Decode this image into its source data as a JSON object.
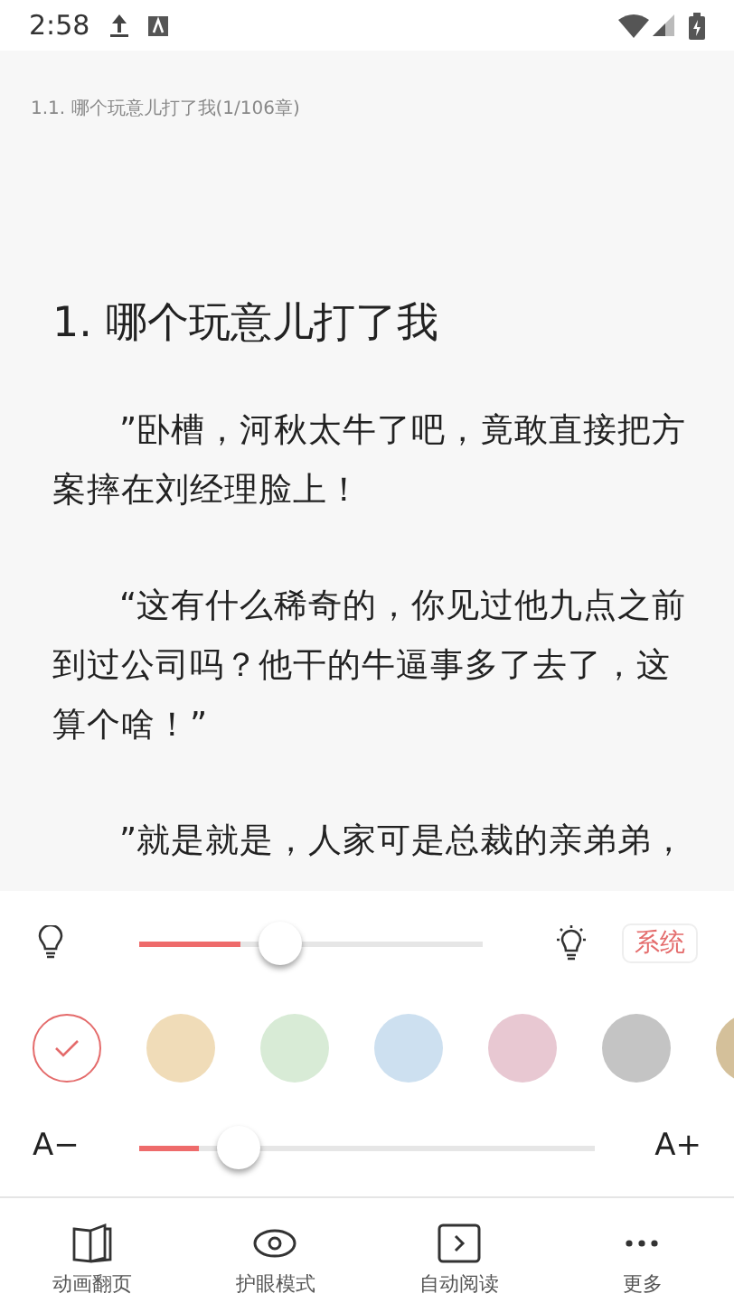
{
  "status_bar": {
    "time": "2:58"
  },
  "header": {
    "chapter_info": "1.1. 哪个玩意儿打了我(1/106章)"
  },
  "content": {
    "title": "1. 哪个玩意儿打了我",
    "paragraphs": [
      "”卧槽，河秋太牛了吧，竟敢直接把方案摔在刘经理脸上！",
      "“这有什么稀奇的，你见过他九点之前到过公司吗？他干的牛逼事多了去了，这算个啥！”",
      "”就是就是，人家可是总裁的亲弟弟，"
    ]
  },
  "brightness": {
    "level": 0.41,
    "system_button": "系统"
  },
  "backgrounds": [
    {
      "color": "#ffffff",
      "selected": true
    },
    {
      "color": "#f0dcb8",
      "selected": false
    },
    {
      "color": "#d8ebd6",
      "selected": false
    },
    {
      "color": "#cde0f0",
      "selected": false
    },
    {
      "color": "#e8c8d2",
      "selected": false
    },
    {
      "color": "#c4c4c4",
      "selected": false
    },
    {
      "color": "#d4c09a",
      "selected": false
    }
  ],
  "font_size": {
    "decrease": "A−",
    "increase": "A+",
    "level": 0.22
  },
  "bottom_nav": [
    {
      "kind": "page",
      "label": "动画翻页"
    },
    {
      "kind": "eye",
      "label": "护眼模式"
    },
    {
      "kind": "play",
      "label": "自动阅读"
    },
    {
      "kind": "more",
      "label": "更多"
    }
  ]
}
